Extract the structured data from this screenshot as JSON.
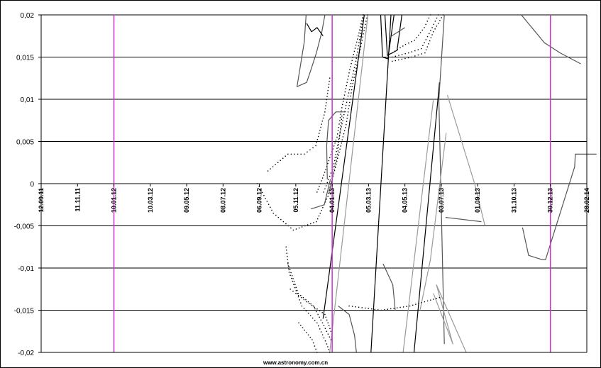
{
  "chart_data": {
    "type": "scatter",
    "title": "",
    "xlabel": "",
    "ylabel": "",
    "ylim": [
      -0.02,
      0.02
    ],
    "y_ticks": [
      {
        "value": 0.02,
        "label": "0,02"
      },
      {
        "value": 0.015,
        "label": "0,015"
      },
      {
        "value": 0.01,
        "label": "0,01"
      },
      {
        "value": 0.005,
        "label": "0,005"
      },
      {
        "value": 0,
        "label": "0"
      },
      {
        "value": -0.005,
        "label": "-0,005"
      },
      {
        "value": -0.01,
        "label": "-0,01"
      },
      {
        "value": -0.015,
        "label": "-0,015"
      },
      {
        "value": -0.02,
        "label": "-0,02"
      }
    ],
    "x_ticks": [
      "12.09.11",
      "11.11.11",
      "10.01.12",
      "10.03.12",
      "09.05.12",
      "08.07.12",
      "06.09.12",
      "05.11.12",
      "04.01.13",
      "05.03.13",
      "04.05.13",
      "03.07.13",
      "01.09.13",
      "31.10.13",
      "30.12.13",
      "28.02.14"
    ],
    "grid": "horizontal",
    "legend": "none",
    "vertical_markers": [
      "10.01.12",
      "04.01.13",
      "30.12.13"
    ],
    "colors": {
      "marker": "#cc33cc",
      "grid": "#000000",
      "series_dark": "#000000",
      "series_mid": "#555555",
      "series_light": "#9a9a9a"
    },
    "series": [
      {
        "color": "#000000",
        "style": "line",
        "points": [
          [
            "20.12.12",
            -0.016
          ],
          [
            "26.02.13",
            0.02
          ]
        ]
      },
      {
        "color": "#9a9a9a",
        "style": "line",
        "points": [
          [
            "31.12.12",
            -0.02
          ],
          [
            "04.03.13",
            0.02
          ]
        ]
      },
      {
        "color": "#000000",
        "style": "line",
        "points": [
          [
            "09.03.13",
            -0.02
          ],
          [
            "11.04.13",
            0.02
          ]
        ]
      },
      {
        "color": "#000000",
        "style": "line",
        "points": [
          [
            "19.05.13",
            -0.02
          ],
          [
            "30.06.13",
            0.012
          ]
        ]
      },
      {
        "color": "#9a9a9a",
        "style": "line",
        "points": [
          [
            "01.05.13",
            -0.02
          ],
          [
            "20.06.13",
            0.01
          ]
        ]
      },
      {
        "color": "#555555",
        "style": "line",
        "points": [
          [
            "08.07.13",
            -0.019
          ],
          [
            "29.06.13",
            0.01
          ],
          [
            "08.07.13",
            0.02
          ]
        ]
      },
      {
        "color": "#9a9a9a",
        "style": "line",
        "points": [
          [
            "29.05.13",
            -0.015
          ],
          [
            "15.06.13",
            -0.009
          ],
          [
            "11.07.13",
            0.006
          ]
        ]
      },
      {
        "color": "#9a9a9a",
        "style": "line",
        "points": [
          [
            "20.06.13",
            -0.013
          ],
          [
            "22.07.13",
            -0.019
          ],
          [
            "25.06.13",
            -0.012
          ],
          [
            "13.08.13",
            -0.02
          ]
        ]
      },
      {
        "color": "#9a9a9a",
        "style": "line",
        "points": [
          [
            "13.07.13",
            0.0105
          ],
          [
            "27.08.13",
            0.0
          ],
          [
            "13.09.13",
            -0.005
          ]
        ]
      },
      {
        "color": "#555555",
        "style": "line",
        "points": [
          [
            "10.07.13",
            -0.004
          ],
          [
            "07.09.13",
            -0.0045
          ]
        ]
      },
      {
        "color": "#555555",
        "style": "line",
        "points": [
          [
            "16.12.13",
            -0.009
          ],
          [
            "22.12.13",
            -0.009
          ],
          [
            "08.02.14",
            0.002
          ],
          [
            "09.02.14",
            0.0035
          ],
          [
            "16.03.14",
            0.0035
          ]
        ]
      },
      {
        "color": "#555555",
        "style": "line",
        "points": [
          [
            "14.11.13",
            -0.0052
          ],
          [
            "24.11.13",
            -0.0085
          ],
          [
            "16.12.13",
            -0.009
          ]
        ]
      },
      {
        "color": "#555555",
        "style": "line",
        "points": [
          [
            "12.11.13",
            0.02
          ],
          [
            "20.12.13",
            0.0167
          ],
          [
            "15.01.14",
            0.0155
          ],
          [
            "18.02.14",
            0.0142
          ]
        ]
      },
      {
        "color": "#555555",
        "style": "line",
        "points": [
          [
            "22.11.12",
            0.02
          ],
          [
            "19.11.12",
            0.0168
          ],
          [
            "07.11.12",
            0.0115
          ],
          [
            "23.11.12",
            0.012
          ],
          [
            "30.11.12",
            0.0135
          ],
          [
            "09.12.12",
            0.0155
          ],
          [
            "18.12.12",
            0.018
          ],
          [
            "23.12.12",
            0.02
          ]
        ]
      },
      {
        "color": "#000000",
        "style": "line",
        "points": [
          [
            "23.11.12",
            0.019
          ],
          [
            "01.12.12",
            0.018
          ],
          [
            "10.12.12",
            0.0185
          ],
          [
            "20.12.12",
            0.0175
          ]
        ]
      },
      {
        "color": "#000000",
        "style": "line",
        "points": [
          [
            "25.03.13",
            0.02
          ],
          [
            "28.03.13",
            0.015
          ],
          [
            "06.04.13",
            0.0148
          ],
          [
            "16.04.13",
            0.02
          ]
        ]
      },
      {
        "color": "#000000",
        "style": "line",
        "points": [
          [
            "01.04.13",
            0.02
          ],
          [
            "05.04.13",
            0.0152
          ],
          [
            "21.04.13",
            0.0158
          ],
          [
            "29.04.13",
            0.02
          ]
        ]
      },
      {
        "color": "#000000",
        "style": "dots",
        "points": [
          [
            "13.04.13",
            0.0155
          ],
          [
            "05.05.13",
            0.0165
          ],
          [
            "20.05.13",
            0.017
          ],
          [
            "05.06.13",
            0.0185
          ],
          [
            "15.06.13",
            0.02
          ]
        ]
      },
      {
        "color": "#000000",
        "style": "dots",
        "points": [
          [
            "13.04.13",
            0.015
          ],
          [
            "10.05.13",
            0.0155
          ],
          [
            "31.05.13",
            0.016
          ],
          [
            "18.06.13",
            0.0185
          ],
          [
            "28.06.13",
            0.02
          ]
        ]
      },
      {
        "color": "#000000",
        "style": "dots",
        "points": [
          [
            "13.04.13",
            0.0145
          ],
          [
            "15.05.13",
            0.015
          ],
          [
            "06.06.13",
            0.0155
          ],
          [
            "20.06.13",
            0.018
          ],
          [
            "06.07.13",
            0.02
          ]
        ]
      },
      {
        "color": "#000000",
        "style": "dots",
        "points": [
          [
            "30.12.12",
            -0.001
          ],
          [
            "13.01.13",
            0.003
          ],
          [
            "27.01.13",
            0.007
          ],
          [
            "06.02.13",
            0.0115
          ],
          [
            "18.02.13",
            0.0155
          ],
          [
            "03.03.13",
            0.02
          ]
        ]
      },
      {
        "color": "#000000",
        "style": "dots",
        "points": [
          [
            "21.12.12",
            -0.001
          ],
          [
            "06.01.13",
            0.002
          ],
          [
            "17.01.13",
            0.006
          ],
          [
            "29.01.13",
            0.01
          ],
          [
            "12.02.13",
            0.0145
          ],
          [
            "25.02.13",
            0.02
          ]
        ]
      },
      {
        "color": "#000000",
        "style": "dots",
        "points": [
          [
            "10.12.12",
            -0.001
          ],
          [
            "21.12.12",
            0.001
          ],
          [
            "12.01.13",
            0.0055
          ],
          [
            "20.01.13",
            0.009
          ],
          [
            "02.02.13",
            0.0135
          ],
          [
            "16.02.13",
            0.0175
          ],
          [
            "24.02.13",
            0.02
          ]
        ]
      },
      {
        "color": "#000000",
        "style": "dots",
        "points": [
          [
            "03.09.12",
            0.0
          ],
          [
            "29.09.12",
            -0.0035
          ],
          [
            "01.11.12",
            -0.0055
          ],
          [
            "09.12.12",
            -0.0045
          ],
          [
            "28.12.12",
            -0.0015
          ],
          [
            "13.01.13",
            0.0035
          ],
          [
            "20.01.13",
            0.008
          ]
        ]
      },
      {
        "color": "#000000",
        "style": "dots",
        "points": [
          [
            "20.09.12",
            0.0015
          ],
          [
            "23.10.12",
            0.0035
          ],
          [
            "19.11.12",
            0.0035
          ],
          [
            "08.12.12",
            0.0045
          ],
          [
            "23.12.12",
            0.0085
          ],
          [
            "31.12.12",
            0.0125
          ]
        ]
      },
      {
        "color": "#000000",
        "style": "dots",
        "points": [
          [
            "20.10.12",
            -0.0075
          ],
          [
            "25.10.12",
            -0.0105
          ],
          [
            "15.11.12",
            -0.0145
          ],
          [
            "10.12.12",
            -0.0165
          ],
          [
            "26.12.12",
            -0.019
          ],
          [
            "31.12.12",
            -0.02
          ]
        ]
      },
      {
        "color": "#000000",
        "style": "dots",
        "points": [
          [
            "23.10.12",
            -0.0095
          ],
          [
            "09.11.12",
            -0.013
          ],
          [
            "04.12.12",
            -0.0145
          ],
          [
            "19.12.12",
            -0.0165
          ],
          [
            "02.01.13",
            -0.0185
          ]
        ]
      },
      {
        "color": "#000000",
        "style": "dots",
        "points": [
          [
            "27.10.12",
            -0.0125
          ],
          [
            "23.11.12",
            -0.014
          ],
          [
            "23.12.12",
            -0.0155
          ],
          [
            "02.01.13",
            -0.0175
          ]
        ]
      },
      {
        "color": "#000000",
        "style": "dots",
        "points": [
          [
            "10.11.12",
            -0.0165
          ],
          [
            "02.12.12",
            -0.0185
          ],
          [
            "10.12.12",
            -0.02
          ]
        ]
      },
      {
        "color": "#555555",
        "style": "line",
        "points": [
          [
            "30.11.12",
            -0.003
          ],
          [
            "22.12.12",
            -0.0025
          ],
          [
            "01.01.13",
            0.0005
          ]
        ]
      },
      {
        "color": "#555555",
        "style": "line",
        "points": [
          [
            "27.12.12",
            0.0005
          ],
          [
            "26.12.12",
            0.0045
          ],
          [
            "29.12.12",
            0.0075
          ],
          [
            "10.01.13",
            0.0085
          ],
          [
            "27.01.13",
            0.0085
          ]
        ]
      },
      {
        "color": "#555555",
        "style": "line",
        "points": [
          [
            "14.01.13",
            -0.0145
          ],
          [
            "01.02.13",
            -0.0155
          ],
          [
            "10.02.13",
            -0.018
          ],
          [
            "13.02.13",
            -0.02
          ]
        ]
      },
      {
        "color": "#555555",
        "style": "line",
        "points": [
          [
            "29.03.13",
            -0.0095
          ],
          [
            "14.04.13",
            -0.012
          ],
          [
            "18.04.13",
            -0.015
          ]
        ]
      },
      {
        "color": "#555555",
        "style": "line",
        "points": [
          [
            "08.04.13",
            0.017
          ],
          [
            "12.04.13",
            0.0175
          ],
          [
            "04.05.13",
            0.0185
          ]
        ]
      },
      {
        "color": "#000000",
        "style": "dots",
        "points": [
          [
            "01.02.13",
            -0.0145
          ],
          [
            "26.03.13",
            -0.015
          ],
          [
            "12.05.13",
            -0.0145
          ],
          [
            "30.06.13",
            -0.0135
          ]
        ]
      }
    ],
    "credit": "www.astronomy.com.cn"
  }
}
